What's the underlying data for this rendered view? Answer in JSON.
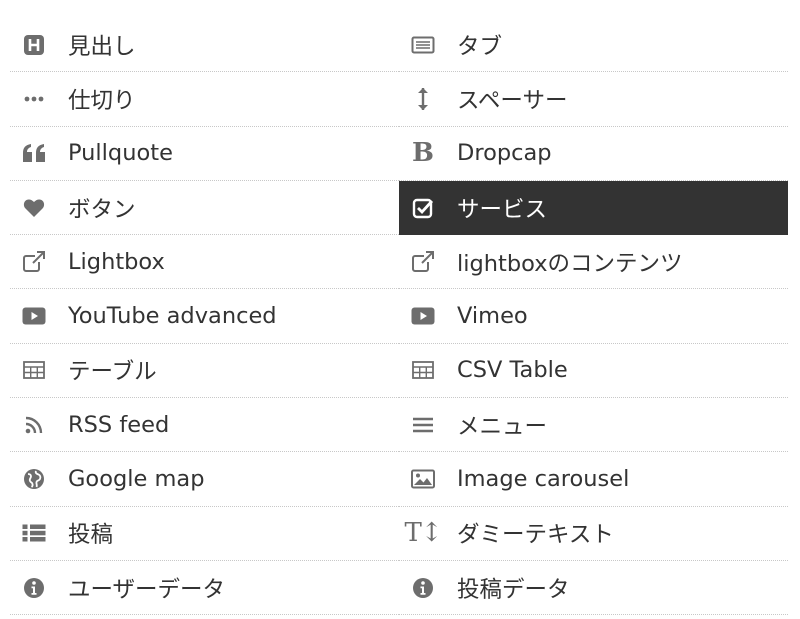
{
  "accent_colors": {
    "selected_background": "#333333",
    "selected_text": "#ffffff",
    "icon": "#6d6d6d",
    "text": "#333333"
  },
  "blocks": [
    {
      "label": "見出し",
      "icon": "heading-icon",
      "selected": false
    },
    {
      "label": "タブ",
      "icon": "tabs-icon",
      "selected": false
    },
    {
      "label": "仕切り",
      "icon": "divider-icon",
      "selected": false
    },
    {
      "label": "スペーサー",
      "icon": "spacer-icon",
      "selected": false
    },
    {
      "label": "Pullquote",
      "icon": "quote-icon",
      "selected": false
    },
    {
      "label": "Dropcap",
      "icon": "dropcap-icon",
      "glyph": "B",
      "selected": false
    },
    {
      "label": "ボタン",
      "icon": "heart-icon",
      "selected": false
    },
    {
      "label": "サービス",
      "icon": "checkbox-icon",
      "selected": true
    },
    {
      "label": "Lightbox",
      "icon": "external-link-icon",
      "selected": false
    },
    {
      "label": "lightboxのコンテンツ",
      "icon": "external-link-icon",
      "selected": false
    },
    {
      "label": "YouTube advanced",
      "icon": "play-icon",
      "selected": false
    },
    {
      "label": "Vimeo",
      "icon": "play-icon",
      "selected": false
    },
    {
      "label": "テーブル",
      "icon": "table-icon",
      "selected": false
    },
    {
      "label": "CSV Table",
      "icon": "table-icon",
      "selected": false
    },
    {
      "label": "RSS feed",
      "icon": "rss-icon",
      "selected": false
    },
    {
      "label": "メニュー",
      "icon": "menu-icon",
      "selected": false
    },
    {
      "label": "Google map",
      "icon": "globe-icon",
      "selected": false
    },
    {
      "label": "Image carousel",
      "icon": "image-icon",
      "selected": false
    },
    {
      "label": "投稿",
      "icon": "list-icon",
      "selected": false
    },
    {
      "label": "ダミーテキスト",
      "icon": "text-height-icon",
      "glyph": "T↕",
      "selected": false
    },
    {
      "label": "ユーザーデータ",
      "icon": "info-icon",
      "selected": false
    },
    {
      "label": "投稿データ",
      "icon": "info-icon",
      "selected": false
    }
  ]
}
